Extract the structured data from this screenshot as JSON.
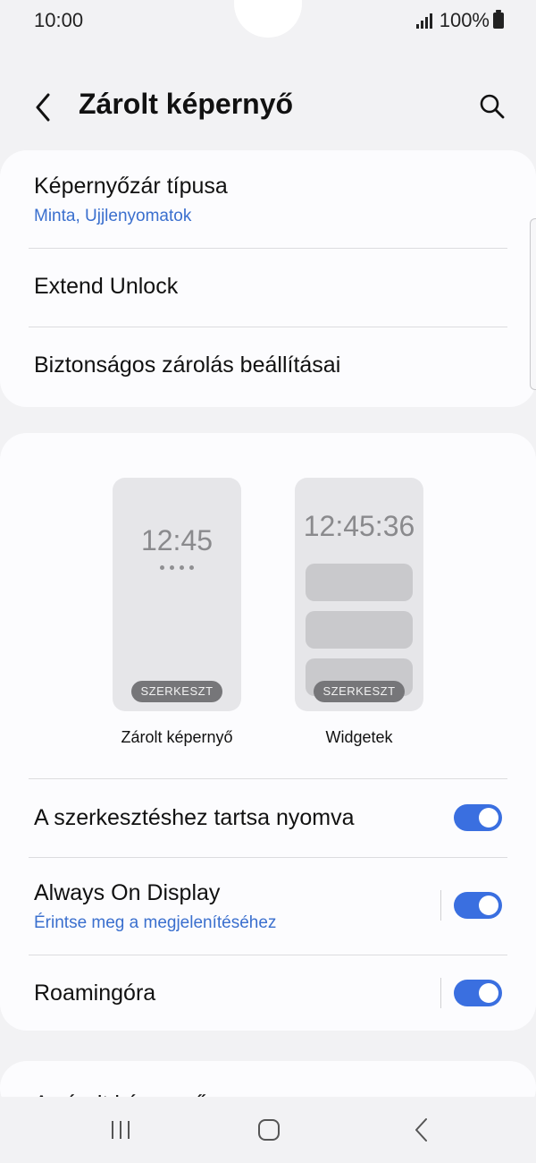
{
  "status": {
    "time": "10:00",
    "battery": "100%"
  },
  "header": {
    "title": "Zárolt képernyő"
  },
  "security": {
    "lock_type_title": "Képernyőzár típusa",
    "lock_type_value": "Minta, Ujjlenyomatok",
    "extend_unlock": "Extend Unlock",
    "secure_lock_settings": "Biztonságos zárolás beállításai"
  },
  "previews": {
    "lock_clock": "12:45",
    "widget_clock": "12:45:36",
    "edit_label": "SZERKESZT",
    "lock_label": "Zárolt képernyő",
    "widget_label": "Widgetek"
  },
  "settings": {
    "hold_to_edit": "A szerkesztéshez tartsa nyomva",
    "hold_to_edit_on": true,
    "aod_title": "Always On Display",
    "aod_sub": "Érintse meg a megjelenítéséhez",
    "aod_on": true,
    "roaming_clock": "Roamingóra",
    "roaming_on": true
  },
  "next_card": {
    "partial_title": "A zárolt képernyő"
  },
  "colors": {
    "accent": "#3a6fe0",
    "link": "#3a6fce",
    "background": "#f2f2f4",
    "card": "#fcfcfe"
  }
}
